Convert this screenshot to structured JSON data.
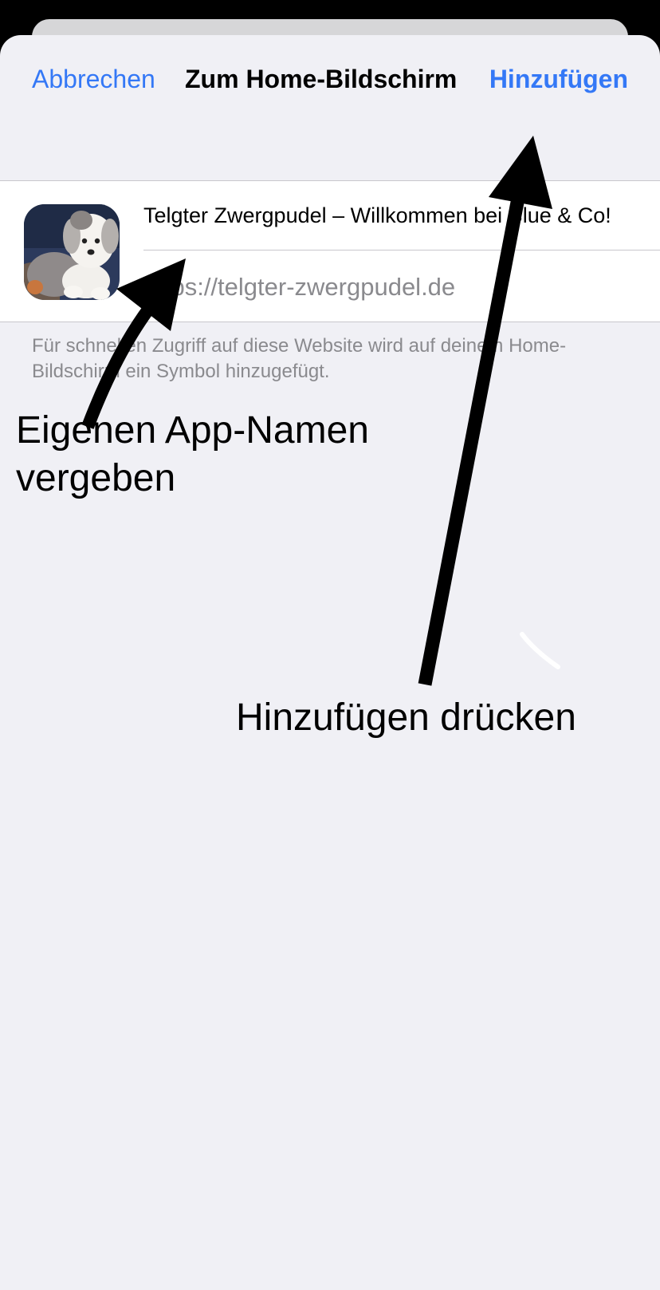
{
  "nav": {
    "cancel_label": "Abbrechen",
    "title": "Zum Home-Bildschirm",
    "add_label": "Hinzufügen"
  },
  "bookmark": {
    "name_value": "Telgter Zwergpudel – Willkommen bei Blue & Co!",
    "url": "https://telgter-zwergpudel.de",
    "icon": "dog-photo-icon"
  },
  "footer_note": "Für schnellen Zugriff auf diese Website wird auf deinem Home-Bildschirm ein Symbol hinzugefügt.",
  "annotations": {
    "rename_hint_line1": "Eigenen App-Namen",
    "rename_hint_line2": "vergeben",
    "add_hint": "Hinzufügen drücken"
  },
  "colors": {
    "accent": "#3478f6",
    "sheet_background": "#f0f0f5",
    "secondary_text": "#8a8a8e",
    "annotation_arrows": "#000000"
  }
}
